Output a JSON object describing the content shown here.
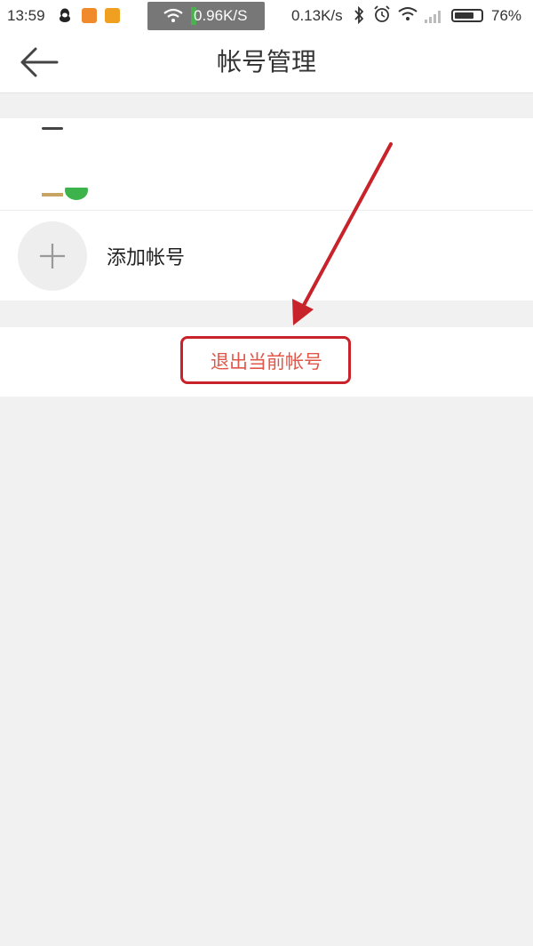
{
  "status_bar": {
    "time": "13:59",
    "hotspot_speed": "0.96K/S",
    "network_speed": "0.13K/s",
    "battery_percent": "76%",
    "battery_level": 0.76,
    "icons": [
      "qq-icon",
      "app-icon",
      "app-icon",
      "wifi-icon",
      "bluetooth-icon",
      "alarm-icon",
      "wifi-icon",
      "signal-icon",
      "battery-icon"
    ]
  },
  "header": {
    "title": "帐号管理",
    "back_icon": "arrow-left-icon"
  },
  "accounts": {
    "add_label": "添加帐号",
    "add_icon": "plus-icon"
  },
  "logout": {
    "label": "退出当前帐号"
  },
  "colors": {
    "background": "#f1f1f1",
    "logout_text": "#e0574a",
    "annotation_red": "#c8232a"
  }
}
